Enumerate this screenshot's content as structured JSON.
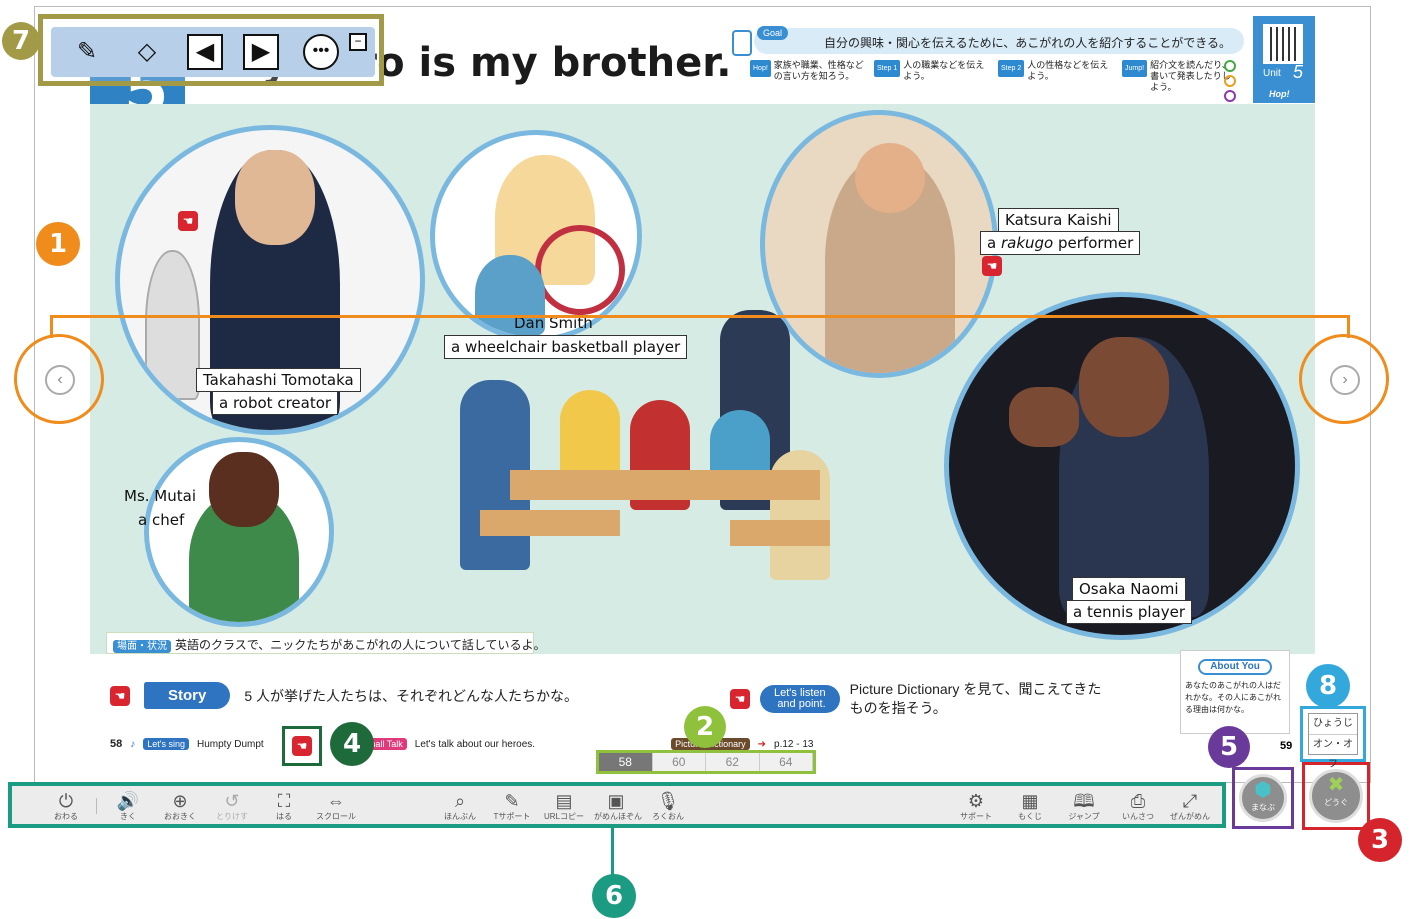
{
  "header": {
    "unit_number": "5",
    "title": "My hero is my brother.",
    "goal_tag": "Goal",
    "goal_text": "自分の興味・関心を伝えるために、あこがれの人を紹介することができる。",
    "steps": [
      {
        "tag": "Hop!",
        "text": "家族や職業、性格などの言い方を知ろう。"
      },
      {
        "tag": "Step 1",
        "text": "人の職業などを伝えよう。"
      },
      {
        "tag": "Step 2",
        "text": "人の性格などを伝えよう。"
      },
      {
        "tag": "Jump!",
        "text": "紹介文を読んだり、書いて発表したりしよう。"
      }
    ],
    "unit_label": "Unit",
    "unit_badge_number": "5",
    "hop_tag": "Hop!"
  },
  "people": [
    {
      "name": "Takahashi Tomotaka",
      "role": "a robot creator"
    },
    {
      "name": "Dan Smith",
      "role": "a wheelchair basketball player"
    },
    {
      "name": "Katsura Kaishi",
      "role_prefix": "a ",
      "role_em": "rakugo",
      "role_suffix": " performer"
    },
    {
      "name": "Osaka Naomi",
      "role": "a tennis player"
    },
    {
      "name": "Ms. Mutai",
      "role": "a chef"
    }
  ],
  "situation": {
    "tag": "場面・状況",
    "text": "英語のクラスで、ニックたちがあこがれの人について話しているよ。"
  },
  "story": {
    "label": "Story",
    "text": "5 人が挙げた人たちは、それぞれどんな人たちかな。"
  },
  "listen": {
    "label_line1": "Let's listen",
    "label_line2": "and point.",
    "text": "Picture Dictionary を見て、聞こえてきたものを指そう。"
  },
  "about_you": {
    "tag": "About You",
    "text": "あなたのあこがれの人はだれかな。その人にあこがれる理由は何かな。"
  },
  "bottom_line": {
    "page_left": "58",
    "lets_sing": "Let's sing",
    "song": "Humpty Dumpt",
    "small_talk": "Small Talk",
    "small_talk_text": "Let's talk about our heroes.",
    "picture_dict": "Picture Dictionary",
    "page_ref": "p.12 - 13",
    "page_right": "59"
  },
  "page_tabs": [
    "58",
    "60",
    "62",
    "64"
  ],
  "active_page_tab": 0,
  "toolbar": [
    {
      "icon": "power-icon",
      "glyph": "⏻",
      "label": "おわる"
    },
    {
      "icon": "speaker-icon",
      "glyph": "🔊",
      "label": "きく"
    },
    {
      "icon": "zoom-in-icon",
      "glyph": "⊕",
      "label": "おおきく"
    },
    {
      "icon": "undo-icon",
      "glyph": "↺",
      "label": "とりけす"
    },
    {
      "icon": "paste-image-icon",
      "glyph": "⛶",
      "label": "はる"
    },
    {
      "icon": "scroll-icon",
      "glyph": "⇔",
      "label": "スクロール"
    },
    {
      "icon": "book-search-icon",
      "glyph": "⌕",
      "label": "ほんぶん"
    },
    {
      "icon": "teacher-support-icon",
      "glyph": "✎",
      "label": "Tサポート"
    },
    {
      "icon": "url-copy-icon",
      "glyph": "▤",
      "label": "URLコピー"
    },
    {
      "icon": "camera-icon",
      "glyph": "▣",
      "label": "がめんほぞん"
    },
    {
      "icon": "microphone-icon",
      "glyph": "🎙",
      "label": "ろくおん"
    },
    {
      "icon": "gear-icon",
      "glyph": "⚙",
      "label": "サポート"
    },
    {
      "icon": "grid-icon",
      "glyph": "▦",
      "label": "もくじ"
    },
    {
      "icon": "book-icon",
      "glyph": "🕮",
      "label": "ジャンプ"
    },
    {
      "icon": "printer-icon",
      "glyph": "⎙",
      "label": "いんさつ"
    },
    {
      "icon": "fullscreen-icon",
      "glyph": "⤢",
      "label": "ぜんがめん"
    }
  ],
  "manabu": {
    "label": "まなぶ",
    "glyph": "⬢"
  },
  "dougu": {
    "label": "どうぐ",
    "glyph": "✖"
  },
  "hyouji": {
    "line1": "ひょうじ",
    "line2": "オン・オフ"
  },
  "nav": {
    "prev_glyph": "‹",
    "next_glyph": "›"
  },
  "pen_tools": {
    "pen": "✎",
    "eraser": "◇",
    "prev": "◀",
    "next": "▶",
    "more": "•••",
    "minimize": "−"
  },
  "markers": [
    "1",
    "2",
    "3",
    "4",
    "5",
    "6",
    "7",
    "8"
  ],
  "colors": {
    "marker1": "#f08c1c",
    "marker2": "#8fc13d",
    "marker3": "#d5242c",
    "marker4": "#1e6a3b",
    "marker5": "#6a3a9b",
    "marker6": "#1a9b82",
    "marker7": "#a39a47",
    "marker8": "#32a8dc",
    "accent_blue": "#2e74c0",
    "scene_bg": "#d5ebe4"
  }
}
